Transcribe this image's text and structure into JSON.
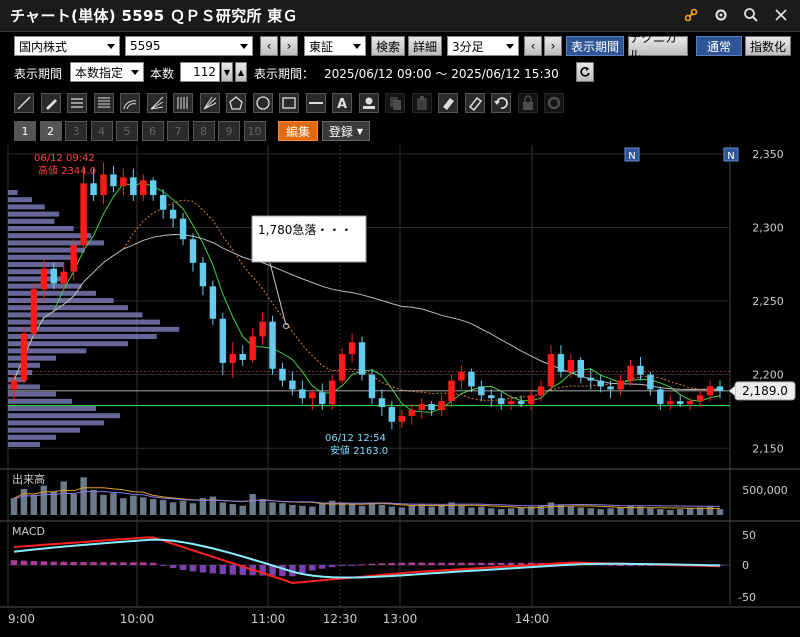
{
  "window": {
    "title": "チャート(単体) 5595 ＱＰＳ研究所 東Ｇ",
    "icons": [
      "link-icon",
      "gear-icon",
      "search-icon",
      "close-icon"
    ]
  },
  "toolbar1": {
    "market_select": "国内株式",
    "code_input": "5595",
    "exchange_select": "東証",
    "search_button": "検索",
    "detail_button": "詳細",
    "interval_select": "3分足",
    "display_period_button": "表示期間",
    "technical_button": "テクニカル",
    "normal_button": "通常",
    "index_button": "指数化"
  },
  "toolbar2": {
    "period_label": "表示期間",
    "period_mode_select": "本数指定",
    "count_label": "本数",
    "count_value": "112",
    "range_label": "表示期間：",
    "range_value": "2025/06/12 09:00 〜 2025/06/12 15:30"
  },
  "drawing_tools": [
    "line-tool-icon",
    "pencil-tool-icon",
    "parallel-lines-icon",
    "horizontal-lines-icon",
    "arc-tool-icon",
    "fan-tool-icon",
    "vertical-lines-icon",
    "gann-tool-icon",
    "pentagon-tool-icon",
    "circle-tool-icon",
    "rectangle-tool-icon",
    "horizontal-line-icon",
    "text-tool-icon",
    "icon-tool-icon",
    "copy-icon",
    "paste-icon",
    "eraser-icon",
    "erase-all-icon",
    "undo-icon",
    "lock-icon",
    "settings-icon"
  ],
  "layout_buttons": [
    "1",
    "2",
    "3",
    "4",
    "5",
    "6",
    "7",
    "8",
    "9",
    "10"
  ],
  "edit_button": "編集",
  "register_button": "登録",
  "chart_data": [
    {
      "type": "candlestick",
      "title": "",
      "price_axis": [
        2350,
        2300,
        2250,
        2200,
        2150
      ],
      "price_axis_labels": [
        "2,350",
        "2,300",
        "2,250",
        "2,200",
        "2,150"
      ],
      "ylim": [
        2140,
        2356
      ],
      "time_axis": [
        "9:00",
        "10:00",
        "11:00",
        "12:30",
        "13:00",
        "14:00"
      ],
      "current_price_label": "2,189.0",
      "high_annotation": {
        "time": "06/12 09:42",
        "label": "高値 2344.0"
      },
      "low_annotation": {
        "time": "06/12 12:54",
        "label": "安値 2163.0"
      },
      "callout_text": "1,780急落・・・",
      "news_markers": [
        "N",
        "N"
      ],
      "candles": [
        [
          2190,
          2200,
          2182,
          2196
        ],
        [
          2196,
          2232,
          2194,
          2228
        ],
        [
          2228,
          2262,
          2226,
          2258
        ],
        [
          2258,
          2278,
          2250,
          2272
        ],
        [
          2272,
          2276,
          2258,
          2262
        ],
        [
          2262,
          2276,
          2256,
          2270
        ],
        [
          2270,
          2292,
          2264,
          2288
        ],
        [
          2288,
          2342,
          2286,
          2330
        ],
        [
          2330,
          2340,
          2318,
          2322
        ],
        [
          2322,
          2344,
          2316,
          2336
        ],
        [
          2336,
          2342,
          2324,
          2328
        ],
        [
          2328,
          2340,
          2322,
          2334
        ],
        [
          2334,
          2340,
          2318,
          2322
        ],
        [
          2322,
          2336,
          2318,
          2332
        ],
        [
          2332,
          2334,
          2318,
          2322
        ],
        [
          2322,
          2326,
          2306,
          2312
        ],
        [
          2312,
          2316,
          2300,
          2306
        ],
        [
          2306,
          2310,
          2288,
          2292
        ],
        [
          2292,
          2296,
          2270,
          2276
        ],
        [
          2276,
          2280,
          2254,
          2260
        ],
        [
          2260,
          2264,
          2234,
          2238
        ],
        [
          2238,
          2242,
          2200,
          2208
        ],
        [
          2208,
          2222,
          2198,
          2214
        ],
        [
          2214,
          2220,
          2206,
          2210
        ],
        [
          2210,
          2232,
          2208,
          2226
        ],
        [
          2226,
          2242,
          2220,
          2236
        ],
        [
          2236,
          2240,
          2200,
          2204
        ],
        [
          2204,
          2208,
          2192,
          2196
        ],
        [
          2196,
          2202,
          2186,
          2190
        ],
        [
          2190,
          2196,
          2180,
          2184
        ],
        [
          2184,
          2190,
          2176,
          2188
        ],
        [
          2188,
          2194,
          2176,
          2180
        ],
        [
          2180,
          2200,
          2176,
          2196
        ],
        [
          2196,
          2218,
          2194,
          2214
        ],
        [
          2214,
          2228,
          2208,
          2222
        ],
        [
          2222,
          2226,
          2196,
          2200
        ],
        [
          2200,
          2204,
          2180,
          2184
        ],
        [
          2184,
          2190,
          2172,
          2178
        ],
        [
          2178,
          2182,
          2163,
          2168
        ],
        [
          2168,
          2176,
          2164,
          2172
        ],
        [
          2172,
          2180,
          2166,
          2176
        ],
        [
          2176,
          2184,
          2170,
          2180
        ],
        [
          2180,
          2182,
          2172,
          2176
        ],
        [
          2176,
          2186,
          2172,
          2182
        ],
        [
          2182,
          2200,
          2178,
          2196
        ],
        [
          2196,
          2206,
          2190,
          2202
        ],
        [
          2202,
          2204,
          2188,
          2192
        ],
        [
          2192,
          2196,
          2182,
          2186
        ],
        [
          2186,
          2190,
          2178,
          2184
        ],
        [
          2184,
          2188,
          2176,
          2180
        ],
        [
          2180,
          2186,
          2176,
          2182
        ],
        [
          2182,
          2186,
          2178,
          2180
        ],
        [
          2180,
          2190,
          2176,
          2186
        ],
        [
          2186,
          2196,
          2182,
          2192
        ],
        [
          2192,
          2220,
          2190,
          2214
        ],
        [
          2214,
          2220,
          2198,
          2202
        ],
        [
          2202,
          2214,
          2198,
          2210
        ],
        [
          2210,
          2212,
          2194,
          2198
        ],
        [
          2198,
          2204,
          2190,
          2196
        ],
        [
          2196,
          2200,
          2188,
          2192
        ],
        [
          2192,
          2196,
          2184,
          2190
        ],
        [
          2190,
          2200,
          2186,
          2196
        ],
        [
          2196,
          2210,
          2192,
          2206
        ],
        [
          2206,
          2212,
          2196,
          2200
        ],
        [
          2200,
          2202,
          2186,
          2190
        ],
        [
          2190,
          2192,
          2176,
          2180
        ],
        [
          2180,
          2186,
          2176,
          2182
        ],
        [
          2182,
          2186,
          2178,
          2180
        ],
        [
          2180,
          2184,
          2176,
          2182
        ],
        [
          2182,
          2190,
          2178,
          2186
        ],
        [
          2186,
          2196,
          2182,
          2192
        ],
        [
          2192,
          2196,
          2184,
          2189
        ]
      ]
    },
    {
      "type": "bar",
      "title": "出来高",
      "axis": [
        "500,000"
      ]
    },
    {
      "type": "line",
      "title": "MACD",
      "axis": [
        "50",
        "0",
        "-50"
      ]
    }
  ],
  "colors": {
    "up": "#ff1a1a",
    "down": "#66ccee",
    "green_line": "#33cc33",
    "macd": "#ff2020",
    "signal": "#88eeff",
    "hist": "#7a3fb0"
  }
}
